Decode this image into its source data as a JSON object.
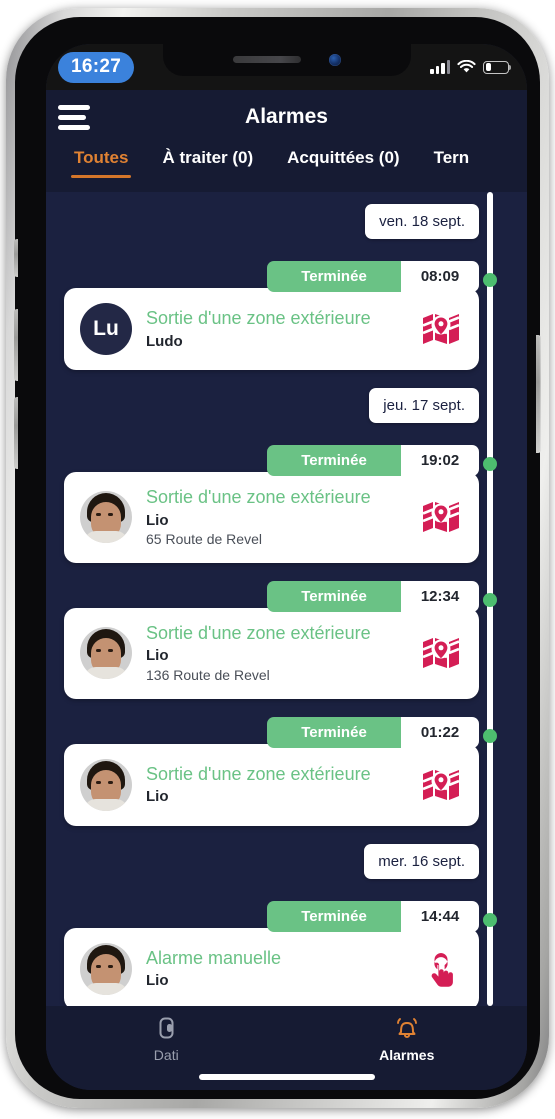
{
  "status_bar": {
    "time": "16:27",
    "signal_icon": "signal-bars-icon",
    "wifi_icon": "wifi-icon",
    "battery_icon": "battery-icon",
    "battery_level_pct": 28
  },
  "header": {
    "menu_icon": "hamburger-menu-icon",
    "title": "Alarmes"
  },
  "tabs": [
    {
      "label": "Toutes",
      "active": true
    },
    {
      "label": "À traiter (0)",
      "active": false
    },
    {
      "label": "Acquittées (0)",
      "active": false
    },
    {
      "label": "Tern",
      "active": false
    }
  ],
  "feed": [
    {
      "kind": "date",
      "label": "ven. 18 sept."
    },
    {
      "kind": "alarm",
      "status": "Terminée",
      "time": "08:09",
      "type": "Sortie d'une zone extérieure",
      "person": "Ludo",
      "address": "",
      "avatar_kind": "initials",
      "initials": "Lu",
      "action_icon": "map-location-icon"
    },
    {
      "kind": "date",
      "label": "jeu. 17 sept."
    },
    {
      "kind": "alarm",
      "status": "Terminée",
      "time": "19:02",
      "type": "Sortie d'une zone extérieure",
      "person": "Lio",
      "address": "65 Route de Revel",
      "avatar_kind": "photo",
      "initials": "",
      "action_icon": "map-location-icon"
    },
    {
      "kind": "alarm",
      "status": "Terminée",
      "time": "12:34",
      "type": "Sortie d'une zone extérieure",
      "person": "Lio",
      "address": "136 Route de Revel",
      "avatar_kind": "photo",
      "initials": "",
      "action_icon": "map-location-icon"
    },
    {
      "kind": "alarm",
      "status": "Terminée",
      "time": "01:22",
      "type": "Sortie d'une zone extérieure",
      "person": "Lio",
      "address": "",
      "avatar_kind": "photo",
      "initials": "",
      "action_icon": "map-location-icon"
    },
    {
      "kind": "date",
      "label": "mer. 16 sept."
    },
    {
      "kind": "alarm",
      "status": "Terminée",
      "time": "14:44",
      "type": "Alarme manuelle",
      "person": "Lio",
      "address": "",
      "avatar_kind": "photo",
      "initials": "",
      "action_icon": "hand-tap-icon"
    }
  ],
  "bottom_nav": [
    {
      "label": "Dati",
      "icon": "device-tracker-icon",
      "active": false
    },
    {
      "label": "Alarmes",
      "icon": "bell-alarm-icon",
      "active": true
    }
  ],
  "colors": {
    "background": "#1b2140",
    "header": "#161b33",
    "accent_orange": "#e08233",
    "status_green": "#6ac285",
    "timeline_dot_green": "#4dbd6f",
    "action_icon_crimson": "#d41e55",
    "card_white": "#ffffff",
    "time_pill_blue": "#3b82dc"
  }
}
